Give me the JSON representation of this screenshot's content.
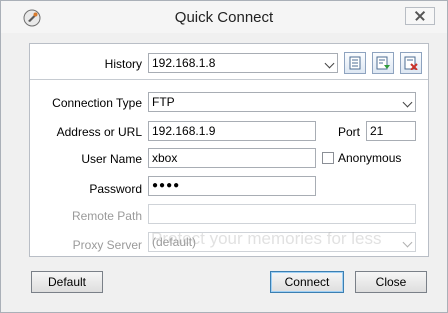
{
  "window": {
    "title": "Quick Connect"
  },
  "history": {
    "label": "History",
    "value": "192.168.1.8"
  },
  "connection_type": {
    "label": "Connection Type",
    "value": "FTP"
  },
  "address": {
    "label": "Address or URL",
    "value": "192.168.1.9"
  },
  "port": {
    "label": "Port",
    "value": "21"
  },
  "user_name": {
    "label": "User Name",
    "value": "xbox"
  },
  "anonymous": {
    "label": "Anonymous",
    "checked": false
  },
  "password": {
    "label": "Password",
    "value": "●●●●"
  },
  "remote_path": {
    "label": "Remote Path",
    "value": ""
  },
  "proxy_server": {
    "label": "Proxy Server",
    "value": "(default)"
  },
  "buttons": {
    "default": "Default",
    "connect": "Connect",
    "close": "Close"
  },
  "watermark": "Protect your memories for less",
  "colors": {
    "accent": "#3c7fb1",
    "delete_icon": "#c8322a",
    "add_icon": "#2e9b3a"
  }
}
